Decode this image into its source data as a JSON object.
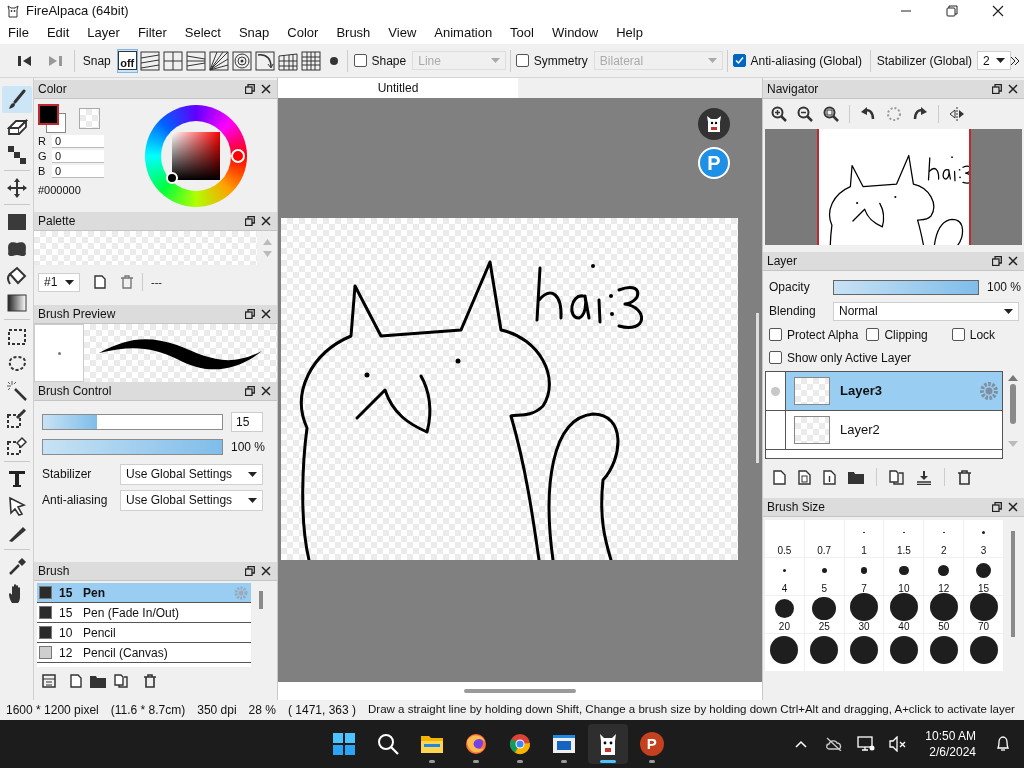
{
  "window": {
    "title": "FireAlpaca (64bit)"
  },
  "menu": [
    "File",
    "Edit",
    "Layer",
    "Filter",
    "Select",
    "Snap",
    "Color",
    "Brush",
    "View",
    "Animation",
    "Tool",
    "Window",
    "Help"
  ],
  "toolbar": {
    "snap_label": "Snap",
    "off_label": "off",
    "snap_modes": [
      {
        "kind": "off",
        "selected": true
      },
      {
        "kind": "parallel",
        "selected": false
      },
      {
        "kind": "cross",
        "selected": false
      },
      {
        "kind": "vanishing",
        "selected": false
      },
      {
        "kind": "radial",
        "selected": false
      },
      {
        "kind": "concentric",
        "selected": false
      },
      {
        "kind": "curve",
        "selected": false
      },
      {
        "kind": "grid3d",
        "selected": false
      },
      {
        "kind": "grid",
        "selected": false
      }
    ],
    "shape": {
      "label": "Shape",
      "checked": false,
      "value": "Line",
      "disabled": true
    },
    "symmetry": {
      "label": "Symmetry",
      "checked": false,
      "value": "Bilateral",
      "disabled": true
    },
    "antialiasing": {
      "label": "Anti-aliasing (Global)",
      "checked": true
    },
    "stabilizer": {
      "label": "Stabilizer (Global)",
      "value": "2"
    }
  },
  "tools": [
    {
      "kind": "brush",
      "selected": true
    },
    {
      "kind": "eraser",
      "selected": false
    },
    {
      "kind": "dot",
      "selected": false,
      "group_end": true
    },
    {
      "kind": "move",
      "selected": false,
      "group_end": true
    },
    {
      "kind": "fill",
      "selected": false
    },
    {
      "kind": "shape",
      "selected": false
    },
    {
      "kind": "bucket",
      "selected": false
    },
    {
      "kind": "gradient",
      "selected": false,
      "group_end": true
    },
    {
      "kind": "select",
      "selected": false
    },
    {
      "kind": "lasso",
      "selected": false
    },
    {
      "kind": "wand",
      "selected": false
    },
    {
      "kind": "select_pen",
      "selected": false
    },
    {
      "kind": "select_eraser",
      "selected": false,
      "group_end": true
    },
    {
      "kind": "text",
      "selected": false
    },
    {
      "kind": "operation",
      "selected": false
    },
    {
      "kind": "divide",
      "selected": false,
      "group_end": true
    },
    {
      "kind": "eyedropper",
      "selected": false
    },
    {
      "kind": "hand",
      "selected": false
    }
  ],
  "color_panel": {
    "title": "Color",
    "channels": [
      {
        "label": "R",
        "value": "0"
      },
      {
        "label": "G",
        "value": "0"
      },
      {
        "label": "B",
        "value": "0"
      }
    ],
    "hex": "#000000"
  },
  "palette_panel": {
    "title": "Palette",
    "index": "#1",
    "name": "---"
  },
  "brush_preview_panel": {
    "title": "Brush Preview"
  },
  "brush_control_panel": {
    "title": "Brush Control",
    "size": {
      "level": 0.3,
      "value": "15"
    },
    "opacity": {
      "level": 1,
      "value": "100 %"
    },
    "selects": [
      {
        "label": "Stabilizer",
        "value": "Use Global Settings"
      },
      {
        "label": "Anti-aliasing",
        "value": "Use Global Settings"
      }
    ]
  },
  "brush_panel": {
    "title": "Brush",
    "brushes": [
      {
        "size": "15",
        "name": "Pen",
        "selected": true,
        "color": "#2b2b2b"
      },
      {
        "size": "15",
        "name": "Pen (Fade In/Out)",
        "selected": false,
        "color": "#2b2b2b"
      },
      {
        "size": "10",
        "name": "Pencil",
        "selected": false,
        "color": "#2b2b2b"
      },
      {
        "size": "12",
        "name": "Pencil (Canvas)",
        "selected": false,
        "color": "#cfcfcf"
      }
    ]
  },
  "canvas": {
    "tab": "Untitled",
    "badge": "P"
  },
  "navigator": {
    "title": "Navigator"
  },
  "layer_panel": {
    "title": "Layer",
    "opacity": {
      "label": "Opacity",
      "level": 1,
      "value": "100 %"
    },
    "blending": {
      "label": "Blending",
      "value": "Normal"
    },
    "options": [
      {
        "label": "Protect Alpha",
        "checked": false
      },
      {
        "label": "Clipping",
        "checked": false
      },
      {
        "label": "Lock",
        "checked": false
      }
    ],
    "show_only_active": {
      "label": "Show only Active Layer",
      "checked": false
    },
    "layers": [
      {
        "name": "Layer3",
        "selected": true,
        "visible_mark": true
      },
      {
        "name": "Layer2",
        "selected": false,
        "visible_mark": false
      }
    ]
  },
  "brush_size_panel": {
    "title": "Brush Size",
    "sizes": [
      "0.5",
      "0.7",
      "1",
      "1.5",
      "2",
      "3",
      "4",
      "5",
      "7",
      "10",
      "12",
      "15",
      "20",
      "25",
      "30",
      "40",
      "50",
      "70"
    ]
  },
  "status_bar": [
    "1600 * 1200 pixel",
    "(11.6 * 8.7cm)",
    "350 dpi",
    "28 %",
    "( 1471, 363 )",
    "Draw a straight line by holding down Shift, Change a brush size by holding down Ctrl+Alt and dragging, A+click to activate layer"
  ],
  "taskbar": {
    "apps": [
      {
        "kind": "start",
        "running": false,
        "selected": false
      },
      {
        "kind": "search",
        "running": false,
        "selected": false
      },
      {
        "kind": "files",
        "running": true,
        "selected": false
      },
      {
        "kind": "firefox",
        "running": true,
        "selected": false
      },
      {
        "kind": "chrome",
        "running": true,
        "selected": false
      },
      {
        "kind": "window",
        "running": true,
        "selected": false
      },
      {
        "kind": "alpaca",
        "running": true,
        "selected": true
      },
      {
        "kind": "p",
        "running": true,
        "selected": false,
        "label": "P"
      }
    ],
    "time": "10:50 AM",
    "date": "2/6/2024"
  }
}
